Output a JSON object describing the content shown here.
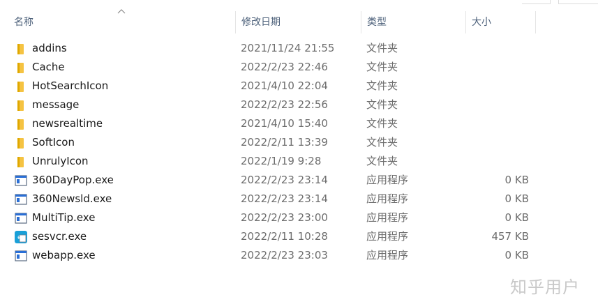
{
  "columns": {
    "name": "名称",
    "date": "修改日期",
    "type": "类型",
    "size": "大小"
  },
  "files": [
    {
      "name": "addins",
      "date": "2021/11/24 21:55",
      "type": "文件夹",
      "size": "",
      "icon": "folder-icon"
    },
    {
      "name": "Cache",
      "date": "2022/2/23 22:46",
      "type": "文件夹",
      "size": "",
      "icon": "folder-icon"
    },
    {
      "name": "HotSearchIcon",
      "date": "2021/4/10 22:04",
      "type": "文件夹",
      "size": "",
      "icon": "folder-icon"
    },
    {
      "name": "message",
      "date": "2022/2/23 22:56",
      "type": "文件夹",
      "size": "",
      "icon": "folder-icon"
    },
    {
      "name": "newsrealtime",
      "date": "2021/4/10 15:40",
      "type": "文件夹",
      "size": "",
      "icon": "folder-icon"
    },
    {
      "name": "SoftIcon",
      "date": "2022/2/11 13:39",
      "type": "文件夹",
      "size": "",
      "icon": "folder-icon"
    },
    {
      "name": "UnrulyIcon",
      "date": "2022/1/19 9:28",
      "type": "文件夹",
      "size": "",
      "icon": "folder-icon"
    },
    {
      "name": "360DayPop.exe",
      "date": "2022/2/23 23:14",
      "type": "应用程序",
      "size": "0 KB",
      "icon": "exe-icon"
    },
    {
      "name": "360Newsld.exe",
      "date": "2022/2/23 23:14",
      "type": "应用程序",
      "size": "0 KB",
      "icon": "exe-icon"
    },
    {
      "name": "MultiTip.exe",
      "date": "2022/2/23 23:00",
      "type": "应用程序",
      "size": "0 KB",
      "icon": "exe-icon"
    },
    {
      "name": "sesvcr.exe",
      "date": "2022/2/11 10:28",
      "type": "应用程序",
      "size": "457 KB",
      "icon": "sesvcr-app-icon"
    },
    {
      "name": "webapp.exe",
      "date": "2022/2/23 23:03",
      "type": "应用程序",
      "size": "0 KB",
      "icon": "exe-icon"
    }
  ],
  "watermark": "知乎用户",
  "colors": {
    "folder": "#f5c342",
    "header_text": "#4c607a",
    "secondary_text": "#6d6d6d",
    "exe_accent": "#2a6fd6"
  }
}
